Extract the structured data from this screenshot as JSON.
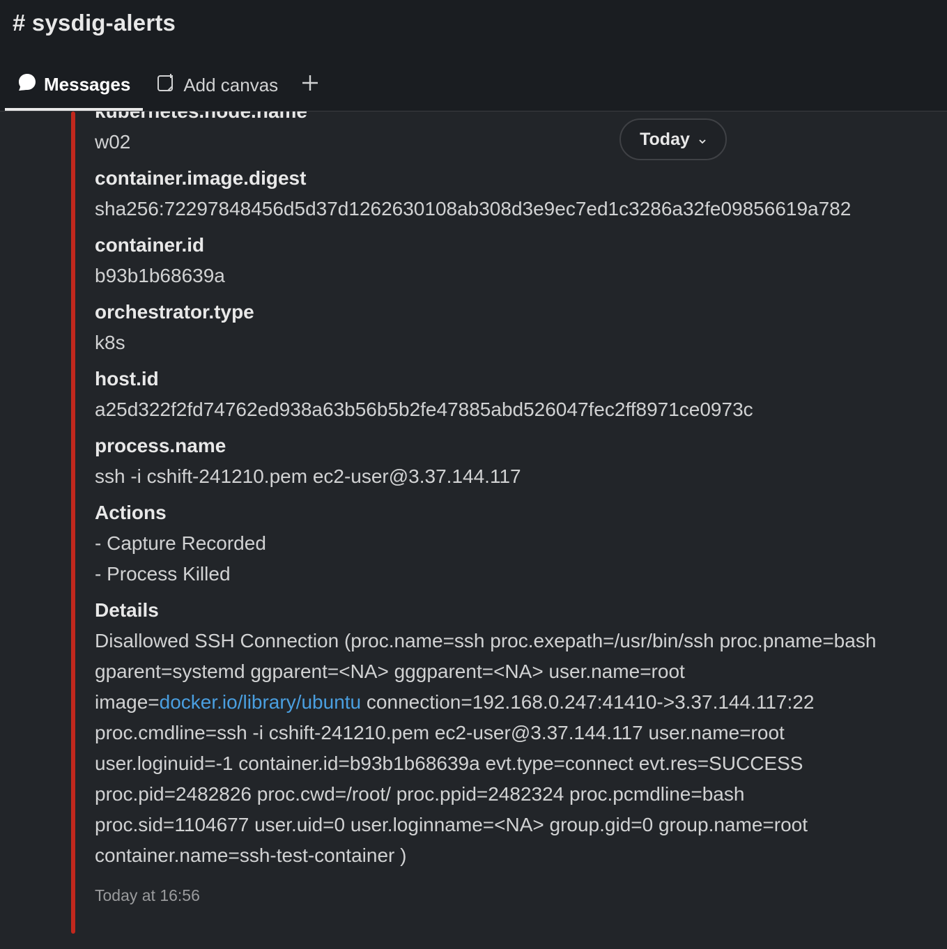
{
  "channel": {
    "title": "# sysdig-alerts"
  },
  "tabs": [
    {
      "label": "Messages",
      "icon": "message-bubble-icon",
      "active": true
    },
    {
      "label": "Add canvas",
      "icon": "canvas-icon"
    },
    {
      "label": "+",
      "icon": "plus-icon"
    }
  ],
  "date_pill": {
    "label": "Today"
  },
  "attachment": {
    "accent_color": "#c1281d",
    "fields": [
      {
        "title": "kubernetes.node.name",
        "value": "w02"
      },
      {
        "title": "container.image.digest",
        "value": "sha256:72297848456d5d37d1262630108ab308d3e9ec7ed1c3286a32fe09856619a782"
      },
      {
        "title": "container.id",
        "value": "b93b1b68639a"
      },
      {
        "title": "orchestrator.type",
        "value": "k8s"
      },
      {
        "title": "host.id",
        "value": "a25d322f2fd74762ed938a63b56b5b2fe47885abd526047fec2ff8971ce0973c"
      },
      {
        "title": "process.name",
        "value": "ssh -i cshift-241210.pem ec2-user@3.37.144.117"
      }
    ],
    "actions": {
      "title": "Actions",
      "items": [
        "- Capture Recorded",
        "- Process Killed"
      ]
    },
    "details": {
      "title": "Details",
      "before_link": "Disallowed SSH Connection (proc.name=ssh proc.exepath=/usr/bin/ssh proc.pname=bash gparent=systemd ggparent=<NA> gggparent=<NA> user.name=root image=",
      "link_text": "docker.io/library/ubuntu",
      "after_link": " connection=192.168.0.247:41410->3.37.144.117:22 proc.cmdline=ssh -i cshift-241210.pem ec2-user@3.37.144.117 user.name=root user.loginuid=-1 container.id=b93b1b68639a evt.type=connect evt.res=SUCCESS proc.pid=2482826 proc.cwd=/root/ proc.ppid=2482324 proc.pcmdline=bash proc.sid=1104677 user.uid=0 user.loginname=<NA> group.gid=0 group.name=root container.name=ssh-test-container )"
    },
    "timestamp": "Today at 16:56"
  }
}
